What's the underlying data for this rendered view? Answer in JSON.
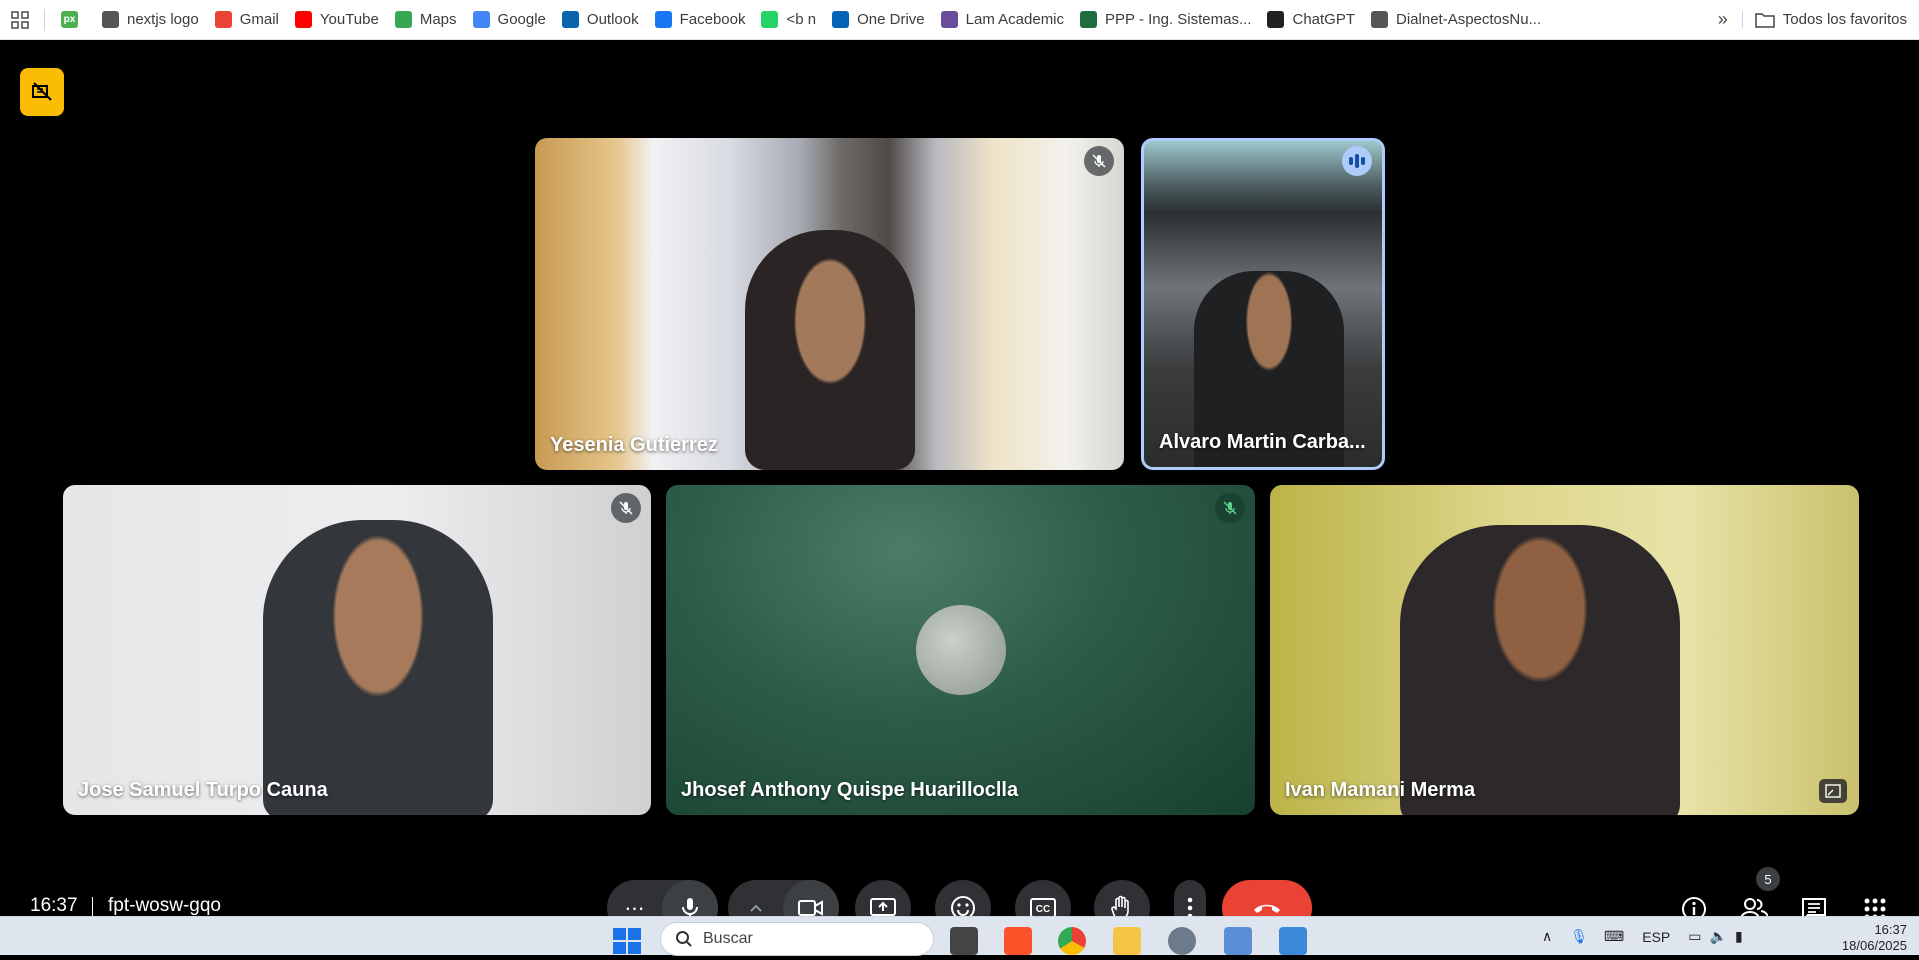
{
  "bookmarks": {
    "items": [
      {
        "label": "",
        "icon": "px-icon",
        "color": "#4caf50"
      },
      {
        "label": "nextjs logo",
        "icon": "globe-icon",
        "color": "#555555"
      },
      {
        "label": "Gmail",
        "icon": "gmail-icon",
        "color": "#ea4335"
      },
      {
        "label": "YouTube",
        "icon": "youtube-icon",
        "color": "#ff0000"
      },
      {
        "label": "Maps",
        "icon": "maps-icon",
        "color": "#34a853"
      },
      {
        "label": "Google",
        "icon": "google-icon",
        "color": "#4285f4"
      },
      {
        "label": "Outlook",
        "icon": "outlook-icon",
        "color": "#0a64ad"
      },
      {
        "label": "Facebook",
        "icon": "facebook-icon",
        "color": "#1877f2"
      },
      {
        "label": "<b n",
        "icon": "whatsapp-icon",
        "color": "#25d366"
      },
      {
        "label": "One Drive",
        "icon": "onedrive-icon",
        "color": "#0364b8"
      },
      {
        "label": "Lam Academic",
        "icon": "lam-icon",
        "color": "#6a4c9c"
      },
      {
        "label": "PPP - Ing. Sistemas...",
        "icon": "excel-icon",
        "color": "#1d6f42"
      },
      {
        "label": "ChatGPT",
        "icon": "chatgpt-icon",
        "color": "#222222"
      },
      {
        "label": "Dialnet-AspectosNu...",
        "icon": "globe-icon",
        "color": "#555555"
      }
    ],
    "px_text": "px",
    "more": "»",
    "all_favorites": "Todos los favoritos"
  },
  "participants": {
    "t1": {
      "name": "Yesenia Gutierrez",
      "muted": true
    },
    "t2": {
      "name": "Alvaro Martin Carba...",
      "speaking": true
    },
    "t3": {
      "name": "Jose Samuel Turpo Cauna",
      "muted": true
    },
    "t4": {
      "name": "Jhosef Anthony Quispe Huarilloclla",
      "muted": true
    },
    "t5": {
      "name": "Ivan Mamani Merma"
    }
  },
  "controls": {
    "time": "16:37",
    "meeting_code": "fpt-wosw-gqo",
    "people_count": "5"
  },
  "taskbar": {
    "search_placeholder": "Buscar",
    "lang": "ESP",
    "time": "16:37",
    "date": "18/06/2025"
  },
  "colors": {
    "accent": "#fbbc04",
    "hangup": "#ea4335",
    "speaking_border": "#aecbfa"
  }
}
